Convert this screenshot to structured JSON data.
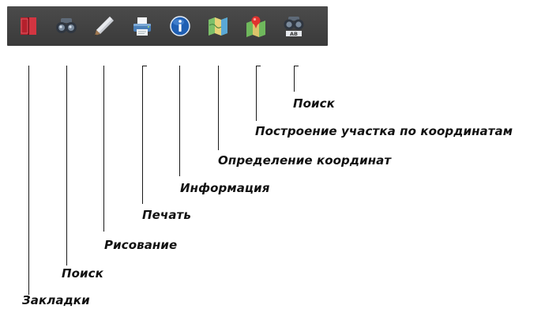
{
  "toolbar": {
    "tools": [
      {
        "id": "bookmarks",
        "icon": "book-icon",
        "label": "Закладки"
      },
      {
        "id": "search",
        "icon": "binoculars-icon",
        "label": "Поиск"
      },
      {
        "id": "drawing",
        "icon": "pencil-icon",
        "label": "Рисование"
      },
      {
        "id": "print",
        "icon": "printer-icon",
        "label": "Печать"
      },
      {
        "id": "info",
        "icon": "info-icon",
        "label": "Информация"
      },
      {
        "id": "coords",
        "icon": "map-icon",
        "label": "Определение координат"
      },
      {
        "id": "plot",
        "icon": "map-pin-icon",
        "label": "Построение участка по координатам"
      },
      {
        "id": "search2",
        "icon": "binoculars-ab-icon",
        "label": "Поиск"
      }
    ]
  },
  "colors": {
    "toolbar_bg": "#404040",
    "label_text": "#111111"
  }
}
